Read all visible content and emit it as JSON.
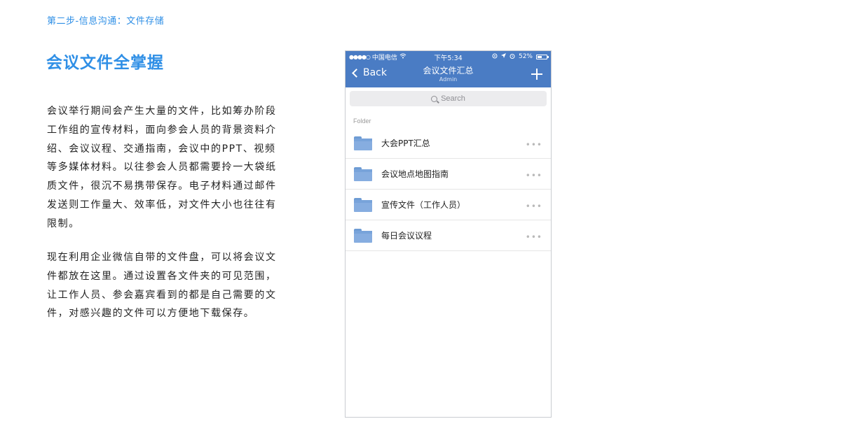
{
  "header": {
    "step": "第二步-信息沟通：文件存储",
    "title": "会议文件全掌握"
  },
  "paragraphs": [
    "会议举行期间会产生大量的文件，比如筹办阶段工作组的宣传材料，面向参会人员的背景资料介绍、会议议程、交通指南，会议中的PPT、视频等多媒体材料。以往参会人员都需要拎一大袋纸质文件，很沉不易携带保存。电子材料通过邮件发送则工作量大、效率低，对文件大小也往往有限制。",
    "现在利用企业微信自带的文件盘，可以将会议文件都放在这里。通过设置各文件夹的可见范围，让工作人员、参会嘉宾看到的都是自己需要的文件，对感兴趣的文件可以方便地下载保存。"
  ],
  "phone": {
    "status_bar": {
      "carrier": "中国电信",
      "time": "下午5:34",
      "battery": "52%",
      "battery_level": 0.52
    },
    "nav": {
      "back_label": "Back",
      "title": "会议文件汇总",
      "subtitle": "Admin",
      "add_icon": "plus-icon"
    },
    "search": {
      "placeholder": "Search"
    },
    "section_label": "Folder",
    "folders": [
      {
        "label": "大会PPT汇总"
      },
      {
        "label": "会议地点地图指南"
      },
      {
        "label": "宣传文件（工作人员）"
      },
      {
        "label": "每日会议议程"
      }
    ],
    "colors": {
      "accent_text": "#2f8fe6",
      "nav_bar": "#4a7cc4",
      "folder_icon": "#86ade0"
    }
  }
}
